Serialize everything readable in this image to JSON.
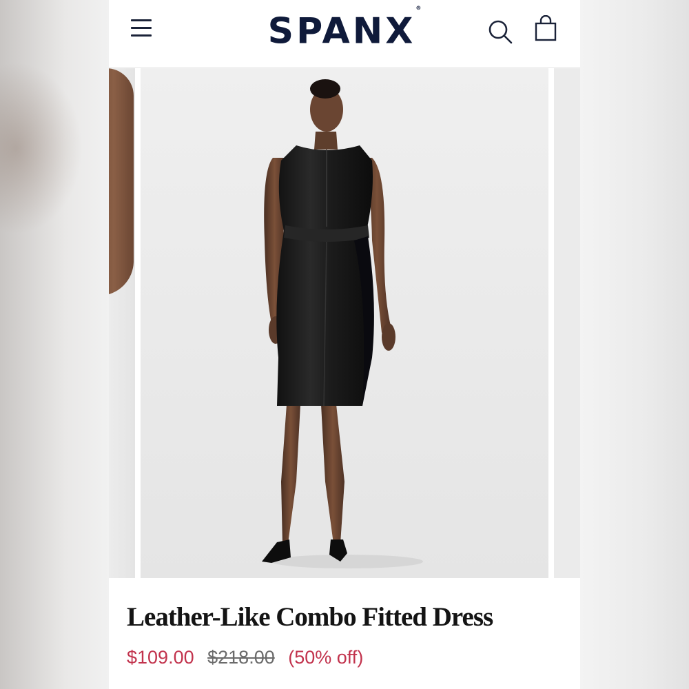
{
  "header": {
    "brand": "SPANX",
    "brand_mark": "®",
    "menu_icon": "hamburger-menu-icon",
    "search_icon": "search-icon",
    "bag_icon": "shopping-bag-icon",
    "brand_color": "#0f1a3a"
  },
  "gallery": {
    "main_image": "model wearing black sleeveless leather-like fitted dress"
  },
  "product": {
    "title": "Leather-Like Combo Fitted Dress",
    "sale_price": "$109.00",
    "original_price": "$218.00",
    "discount": "(50% off)",
    "sale_color": "#c2334d"
  }
}
